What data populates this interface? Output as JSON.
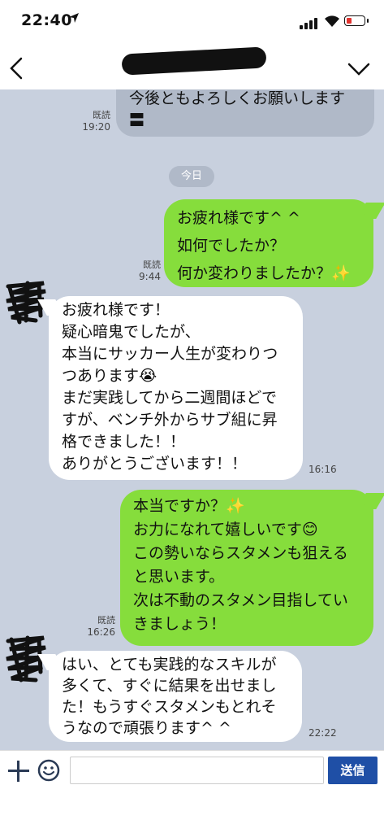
{
  "status_bar": {
    "time": "22:40",
    "location_arrow": "location-arrow-icon",
    "battery_color": "#e2332f",
    "battery_level": 0.3
  },
  "header": {
    "back_icon": "chevron-left-icon",
    "menu_icon": "chevron-down-icon"
  },
  "chat": {
    "date_separator": "今日",
    "messages": [
      {
        "side": "mine",
        "lines": [
          "今後ともよろしくお願いします",
          "〓"
        ],
        "read": "既読",
        "time": "19:20"
      },
      {
        "side": "mine",
        "lines": [
          "お疲れ様です^ ^",
          "如何でしたか？",
          "何か変わりましたか？✨"
        ],
        "read": "既読",
        "time": "9:44"
      },
      {
        "side": "theirs",
        "lines": [
          "お疲れ様です！",
          "疑心暗鬼でしたが、",
          "本当にサッカー人生が変わりつ",
          "つあります😭",
          "まだ実践してから二週間ほどで",
          "すが、ベンチ外からサブ組に昇",
          "格できました！！",
          "ありがとうございます！！"
        ],
        "time": "16:16"
      },
      {
        "side": "mine",
        "lines": [
          "本当ですか？✨",
          "お力になれて嬉しいです😊",
          "この勢いならスタメンも狙える",
          "と思います。",
          "次は不動のスタメン目指してい",
          "きましょう！"
        ],
        "read": "既読",
        "time": "16:26"
      },
      {
        "side": "theirs",
        "lines": [
          "はい、とても実践的なスキルが",
          "多くて、すぐに結果を出せまし",
          "た！もうすぐスタメンもとれそ",
          "うなので頑張ります^ ^"
        ],
        "time": "22:22"
      }
    ]
  },
  "input_bar": {
    "message_value": "",
    "send_label": "送信",
    "colors": {
      "send_bg": "#1f4fa6"
    }
  },
  "colors": {
    "chat_bg": "#c8d0de",
    "my_bubble": "#86dd3c",
    "their_bubble": "#ffffff"
  }
}
